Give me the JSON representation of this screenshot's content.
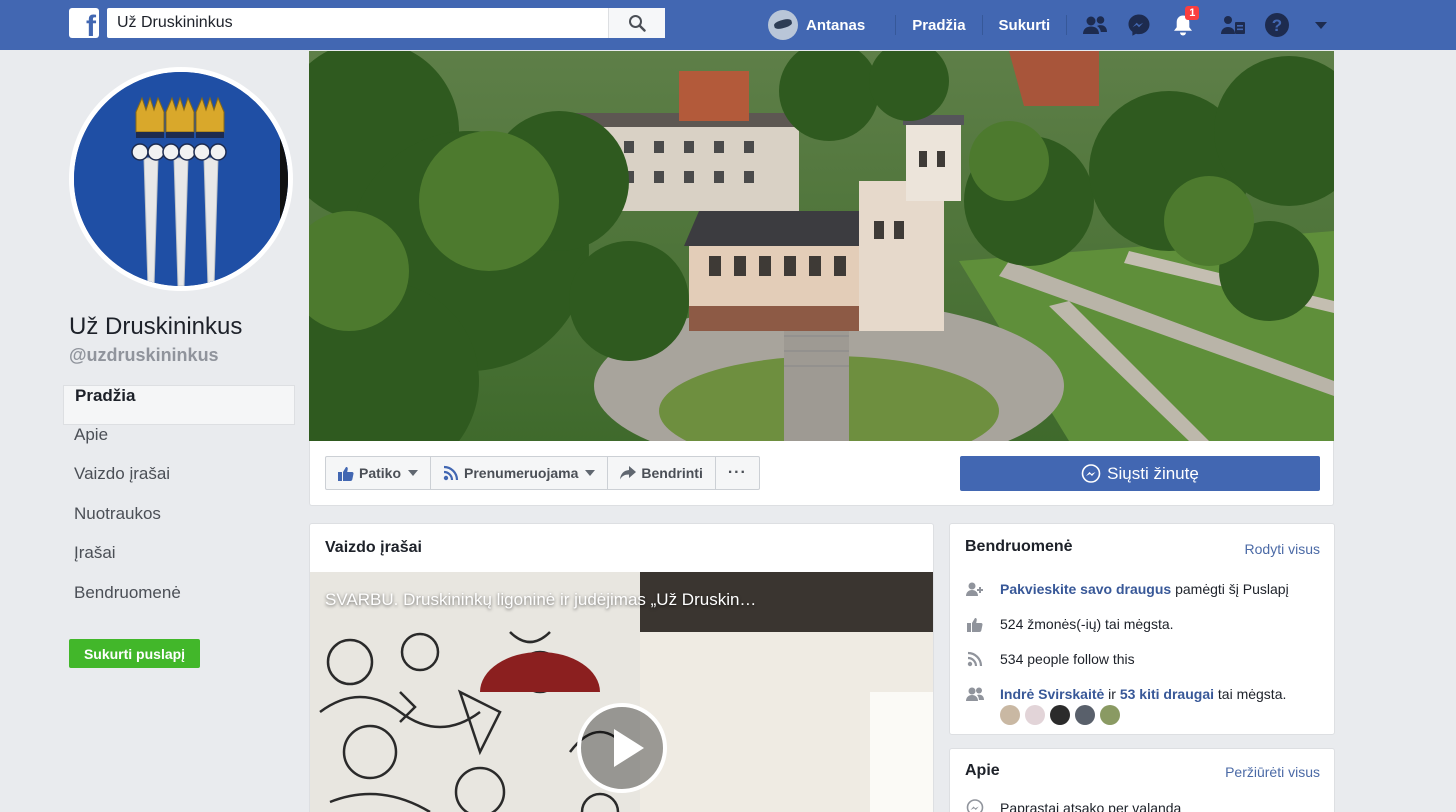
{
  "topbar": {
    "logo": "f",
    "search_value": "Už Druskininkus",
    "user_name": "Antanas",
    "home": "Pradžia",
    "create": "Sukurti",
    "notification_count": "1",
    "icons": [
      "friends-icon",
      "messenger-icon",
      "bell-icon",
      "people-icon",
      "help-icon",
      "caret-down-icon"
    ]
  },
  "page": {
    "name": "Už Druskininkus",
    "handle": "@uzdruskininkus"
  },
  "left_nav": [
    "Pradžia",
    "Apie",
    "Vaizdo įrašai",
    "Nuotraukos",
    "Įrašai",
    "Bendruomenė"
  ],
  "create_page_label": "Sukurti puslapį",
  "actions": {
    "like": "Patiko",
    "follow": "Prenumeruojama",
    "share": "Bendrinti",
    "more": "···",
    "send_message": "Siųsti žinutę"
  },
  "videos": {
    "title": "Vaizdo įrašai",
    "video_title": "SVARBU. Druskininkų ligoninė ir judėjimas „Už Druskin…"
  },
  "community": {
    "title": "Bendruomenė",
    "see_all": "Rodyti visus",
    "invite_link": "Pakvieskite savo draugus",
    "invite_rest": " pamėgti šį Puslapį",
    "likes": "524 žmonės(-ių) tai mėgsta.",
    "follows": "534 people follow this",
    "friend_name": "Indrė Svirskaitė",
    "friend_mid": " ir ",
    "friend_others": "53 kiti draugai",
    "friend_rest": " tai mėgsta."
  },
  "about": {
    "title": "Apie",
    "see_all": "Peržiūrėti visus",
    "first_row": "Paprastai atsako per valandą"
  },
  "colors": {
    "brand": "#4267b2",
    "link": "#385898",
    "create_green": "#42b72a",
    "background": "#e9ebee"
  }
}
